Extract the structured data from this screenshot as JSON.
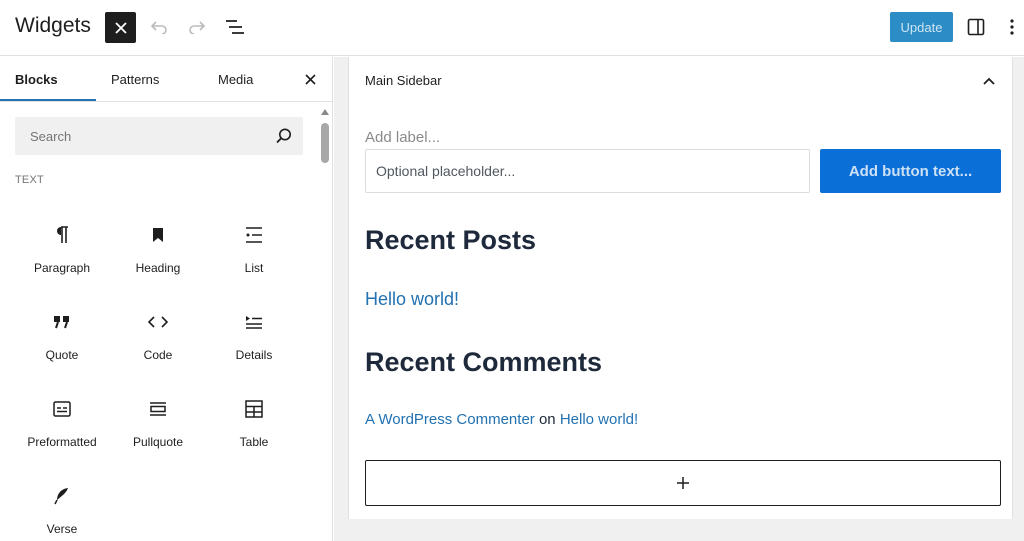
{
  "header": {
    "title": "Widgets",
    "update_label": "Update",
    "colors": {
      "update_bg": "#2b8cc6",
      "close_bg": "#1e1e1e"
    }
  },
  "inserter": {
    "tabs": [
      {
        "label": "Blocks",
        "active": true
      },
      {
        "label": "Patterns",
        "active": false
      },
      {
        "label": "Media",
        "active": false
      }
    ],
    "search_placeholder": "Search",
    "section_title": "TEXT",
    "blocks": [
      {
        "label": "Paragraph",
        "icon": "paragraph-icon"
      },
      {
        "label": "Heading",
        "icon": "heading-icon"
      },
      {
        "label": "List",
        "icon": "list-icon"
      },
      {
        "label": "Quote",
        "icon": "quote-icon"
      },
      {
        "label": "Code",
        "icon": "code-icon"
      },
      {
        "label": "Details",
        "icon": "details-icon"
      },
      {
        "label": "Preformatted",
        "icon": "preformatted-icon"
      },
      {
        "label": "Pullquote",
        "icon": "pullquote-icon"
      },
      {
        "label": "Table",
        "icon": "table-icon"
      },
      {
        "label": "Verse",
        "icon": "verse-icon"
      }
    ]
  },
  "sidebar_area": {
    "title": "Main Sidebar",
    "search_widget": {
      "label_placeholder": "Add label...",
      "input_placeholder": "Optional placeholder...",
      "button_label": "Add button text..."
    },
    "recent_posts_heading": "Recent Posts",
    "recent_posts": [
      "Hello world!"
    ],
    "recent_comments_heading": "Recent Comments",
    "recent_comment": {
      "author": "A WordPress Commenter",
      "connector": "on",
      "post": "Hello world!"
    },
    "colors": {
      "link": "#2271b1",
      "button": "#0a6fd6"
    }
  }
}
